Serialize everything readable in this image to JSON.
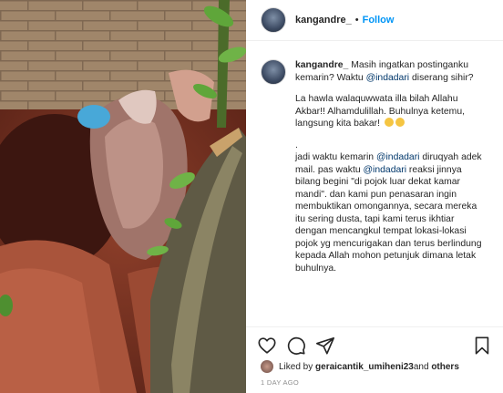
{
  "post": {
    "username": "kangandre_",
    "separator": "•",
    "follow_label": "Follow",
    "caption": {
      "username": "kangandre_",
      "line1_pre": "Masih ingatkan postinganku kemarin? Waktu ",
      "mention1": "@indadari",
      "line1_post": " diserang sihir?",
      "para2": "La hawla walaquwwata illa bilah Allahu Akbar!! Alhamdulillah. Buhulnya ketemu, langsung kita bakar!",
      "para3_dot": ".",
      "para3_pre": "jadi waktu kemarin ",
      "mention2": "@indadari",
      "para3_mid": " diruqyah adek mail. pas waktu ",
      "mention3": "@indadari",
      "para3_post": " reaksi jinnya bilang begini \"di pojok luar dekat kamar mandi\". dan kami pun penasaran ingin membuktikan omongannya, secara mereka itu sering dusta, tapi kami terus ikhtiar dengan mencangkul tempat lokasi-lokasi pojok yg mencurigakan dan terus berlindung kepada Allah mohon petunjuk dimana letak buhulnya."
    },
    "likes": {
      "prefix": "Liked by ",
      "user": "geraicantik_umiheni23",
      "mid": " and ",
      "others": "others"
    },
    "time": "1 DAY AGO",
    "icons": {
      "like": "heart-icon",
      "comment": "comment-icon",
      "share": "paper-plane-icon",
      "save": "bookmark-icon"
    },
    "colors": {
      "accent": "#0095f6",
      "text": "#262626",
      "muted": "#8e8e8e",
      "mention": "#00376b"
    }
  }
}
